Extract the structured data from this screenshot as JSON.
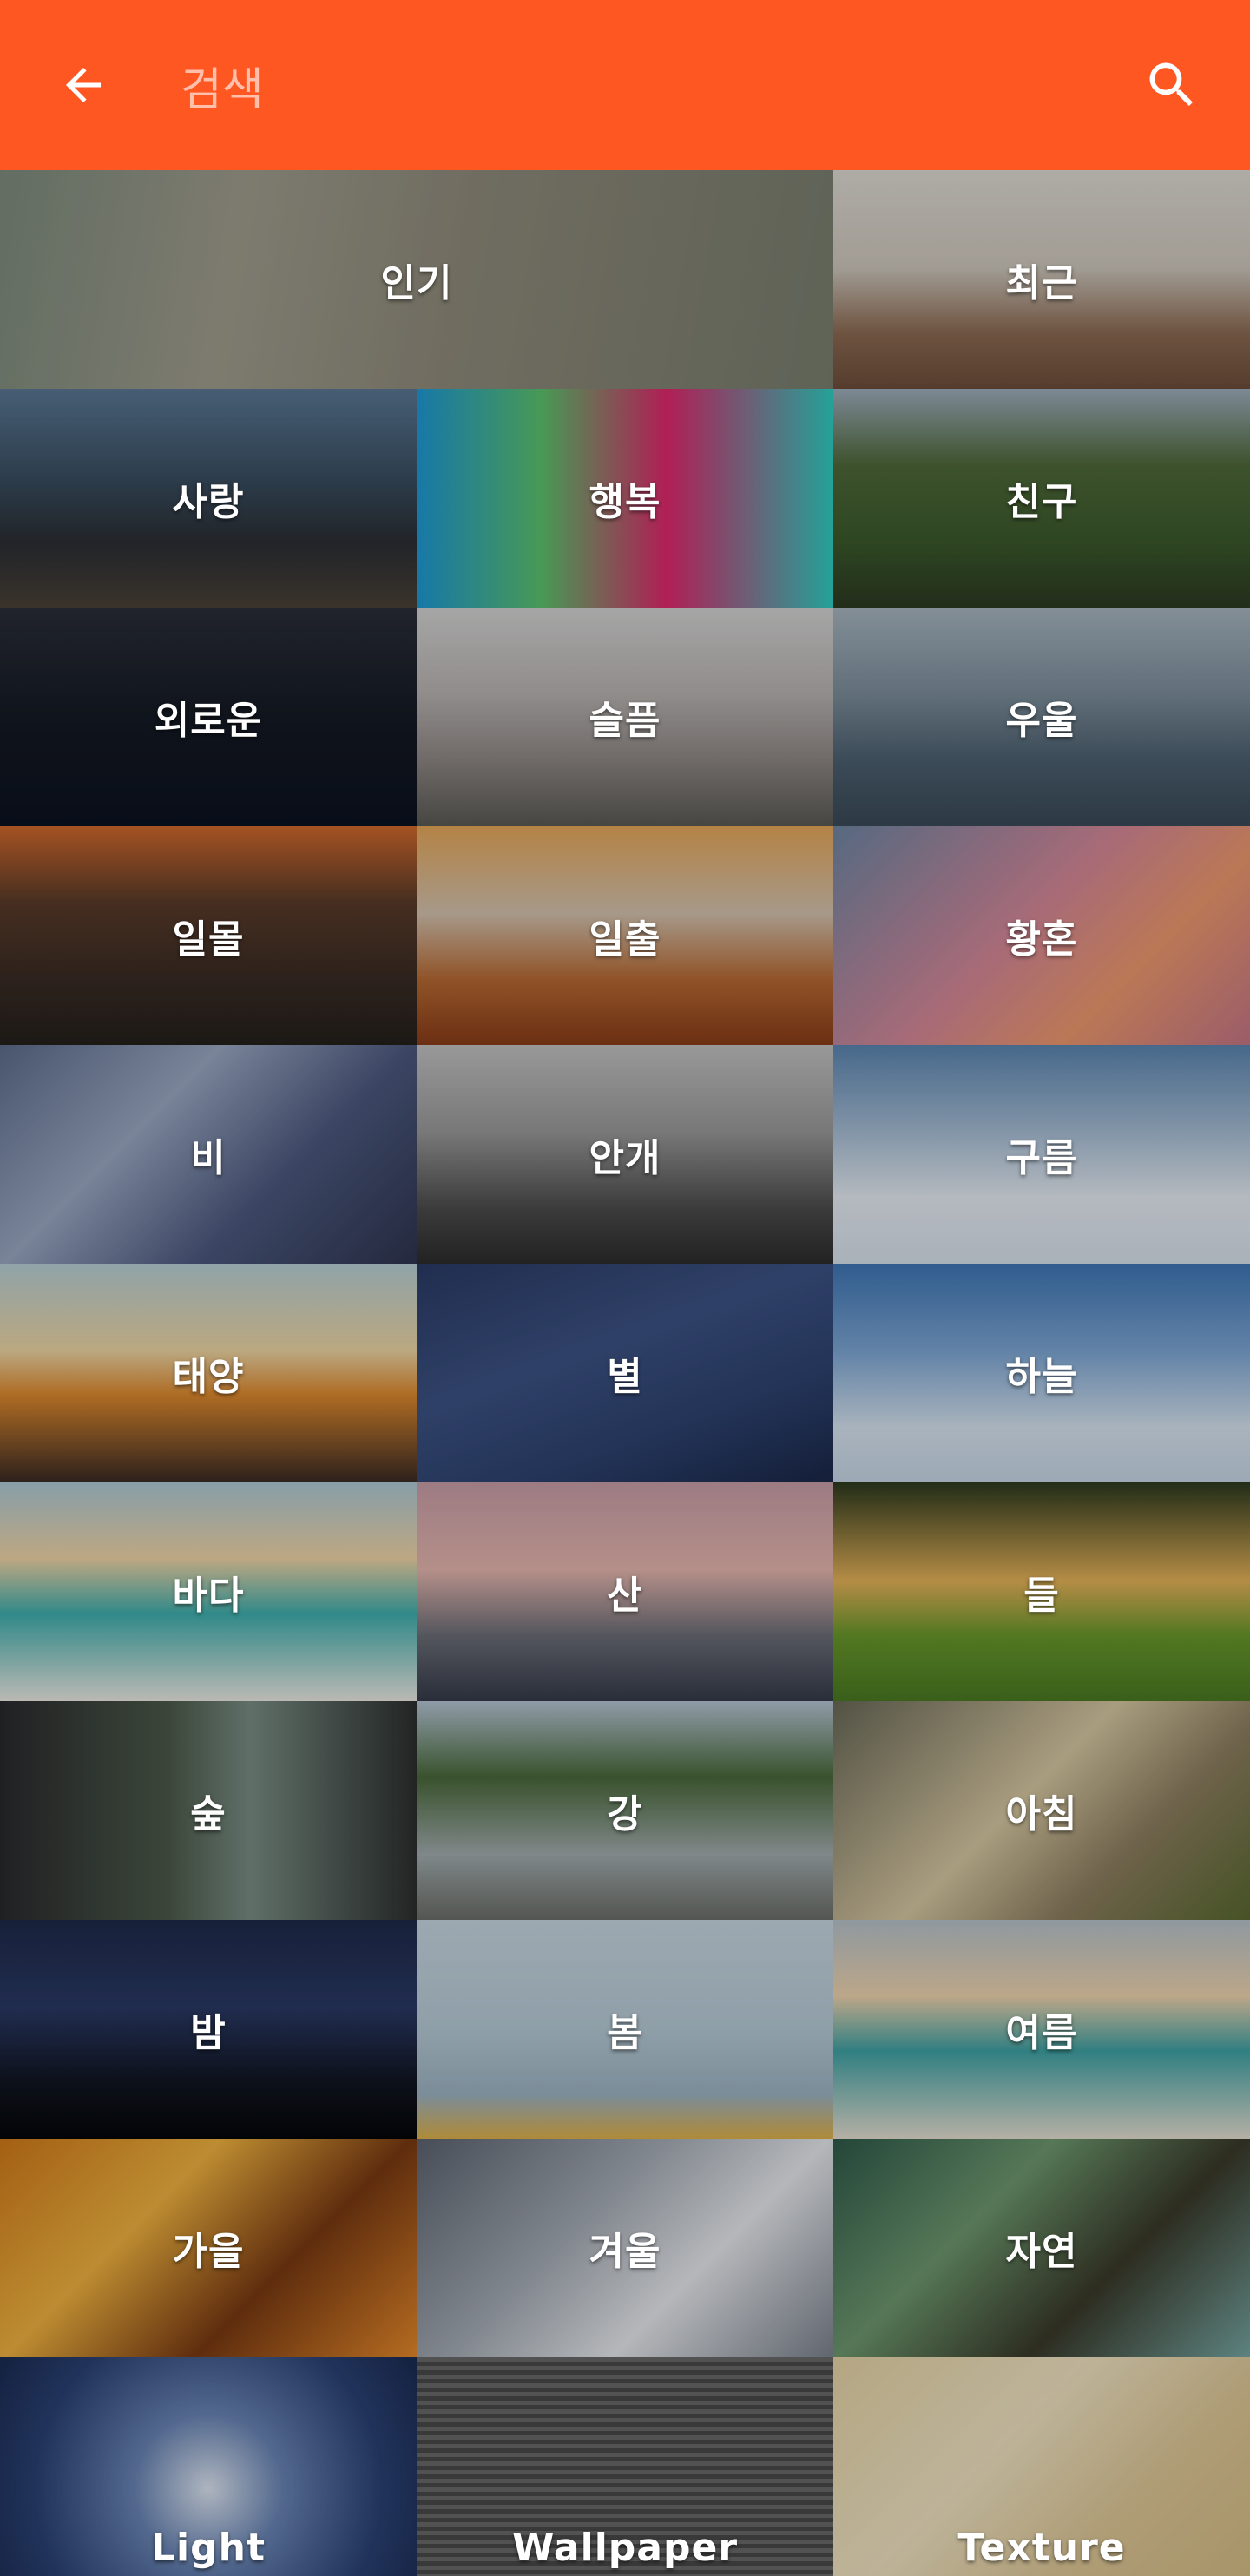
{
  "appbar": {
    "search_placeholder": "검색",
    "back_icon": "arrow-back-icon",
    "search_icon": "search-icon",
    "color": "#ff5722"
  },
  "categories": [
    {
      "label": "인기",
      "bg": "linear-gradient(100deg,#7f8d7e 0%,#a19e8f 28%,#908b7c 55%,#7a7f6f 100%)"
    },
    {
      "label": "최근",
      "bg": "linear-gradient(180deg,#e0dcd5 0%,#cfc8bd 45%,#8c6a52 75%,#6e4e3a 100%)"
    },
    {
      "label": "사랑",
      "bg": "linear-gradient(180deg,#5b7996 0%,#3a4f63 40%,#2b2f34 70%,#4a4238 100%)"
    },
    {
      "label": "행복",
      "bg": "linear-gradient(90deg,#1e9bd8 0%,#5cc46e 30%,#e2286e 60%,#2fd0c4 100%)"
    },
    {
      "label": "친구",
      "bg": "linear-gradient(180deg,#9fb0c0 0%,#4f6a3a 35%,#3b5a2c 70%,#2d3a22 100%)"
    },
    {
      "label": "외로운",
      "bg": "linear-gradient(180deg,#2a2e38 0%,#151a24 50%,#0b1220 100%)"
    },
    {
      "label": "슬픔",
      "bg": "linear-gradient(180deg,#d5d5d5 0%,#b9b4b2 40%,#8f8885 70%,#5a5a54 100%)"
    },
    {
      "label": "우울",
      "bg": "linear-gradient(180deg,#a9b7c2 0%,#7c8e9b 40%,#4c6070 70%,#3a4a58 100%)"
    },
    {
      "label": "일몰",
      "bg": "linear-gradient(180deg,#d36a2c 0%,#5a3b2a 35%,#3a2c24 70%,#24201c 100%)"
    },
    {
      "label": "일출",
      "bg": "linear-gradient(180deg,#e7a95a 0%,#d6c4b0 40%,#b96b33 70%,#8a3c18 100%)"
    },
    {
      "label": "황혼",
      "bg": "linear-gradient(135deg,#6f87a6 0%,#d7899a 45%,#f09a6f 70%,#c77787 100%)"
    },
    {
      "label": "비",
      "bg": "linear-gradient(135deg,#5d6e8c 0%,#9ba9c4 35%,#4d5a80 65%,#2e3550 100%)"
    },
    {
      "label": "안개",
      "bg": "linear-gradient(180deg,#c4c4c4 0%,#9a9a9a 40%,#4c4c4c 75%,#2c2c2c 100%)"
    },
    {
      "label": "구름",
      "bg": "linear-gradient(180deg,#5b86b2 0%,#a9c0d8 40%,#e8eef5 70%,#d9e3ee 100%)"
    },
    {
      "label": "태양",
      "bg": "linear-gradient(180deg,#b9d2d8 0%,#f0d7a4 40%,#e08a2e 60%,#3a2a24 100%)"
    },
    {
      "label": "별",
      "bg": "linear-gradient(160deg,#2a3b66 0%,#3d5385 40%,#2d4270 70%,#1a2748 100%)"
    },
    {
      "label": "하늘",
      "bg": "linear-gradient(180deg,#3e76b6 0%,#7ea8d6 40%,#d9e6f2 75%,#c8d8e8 100%)"
    },
    {
      "label": "바다",
      "bg": "linear-gradient(180deg,#aecbd8 0%,#f3d7a7 35%,#3fb0b0 60%,#f0ede6 100%)"
    },
    {
      "label": "산",
      "bg": "linear-gradient(180deg,#c99ea8 0%,#e8b8b0 40%,#6c6f78 70%,#353b4a 100%)"
    },
    {
      "label": "들",
      "bg": "linear-gradient(180deg,#2c3a1e 0%,#e8b45a 45%,#6a9a2c 70%,#4a7a22 100%)"
    },
    {
      "label": "숲",
      "bg": "linear-gradient(90deg,#2a2a2e 0%,#4c5a4a 40%,#7b8f86 60%,#2c2f2e 100%)"
    },
    {
      "label": "강",
      "bg": "linear-gradient(180deg,#b8c8d8 0%,#4a6a3a 35%,#a4aeb0 70%,#6b6e68 100%)"
    },
    {
      "label": "아침",
      "bg": "linear-gradient(135deg,#6a6a58 0%,#d9c9a3 45%,#8d7f60 70%,#5a6a30 100%)"
    },
    {
      "label": "밤",
      "bg": "linear-gradient(180deg,#1e2a4a 0%,#2a3a66 40%,#101520 75%,#050608 100%)"
    },
    {
      "label": "봄",
      "bg": "linear-gradient(180deg,#c9d8e3 0%,#b8ccd8 50%,#9eb5c4 80%,#e0b24a 100%)"
    },
    {
      "label": "여름",
      "bg": "linear-gradient(180deg,#b8c4cc 0%,#f1d6b0 35%,#3fa3a6 60%,#e8e1d4 100%)"
    },
    {
      "label": "가을",
      "bg": "linear-gradient(135deg,#d27b1a 0%,#f2b440 35%,#7a3a12 65%,#e88a2a 100%)"
    },
    {
      "label": "겨울",
      "bg": "linear-gradient(135deg,#5c6370 0%,#a8afb8 40%,#e8ebef 65%,#7c838e 100%)"
    },
    {
      "label": "자연",
      "bg": "linear-gradient(135deg,#2e5a4a 0%,#6f9a70 35%,#3a3a2a 65%,#77a8a4 100%)"
    },
    {
      "label": "Light",
      "bg": "radial-gradient(circle at 50% 60%,#dfe8f5 0%,#6a86b6 30%,#2b4275 70%,#1a2b52 100%)"
    },
    {
      "label": "Wallpaper",
      "bg": "repeating-linear-gradient(180deg,#6a6a6a 0px,#6a6a6a 5px,#4a4a4a 5px,#4a4a4a 10px)"
    },
    {
      "label": "Texture",
      "bg": "linear-gradient(135deg,#e8d6a8 0%,#f3e6c4 40%,#e0c998 70%,#d8bf88 100%)"
    }
  ]
}
